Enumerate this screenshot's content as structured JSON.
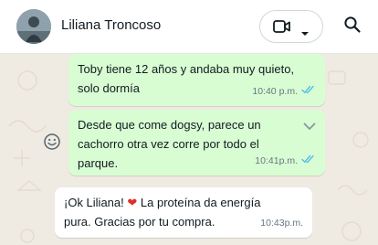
{
  "header": {
    "contact_name": "Liliana Troncoso"
  },
  "icons": {
    "video": "video-call-icon",
    "dropdown": "chevron-down-icon",
    "search": "search-icon",
    "emoji": "emoji-icon",
    "ticks": "double-check-icon"
  },
  "colors": {
    "outgoing_bubble": "#d9fdd3",
    "incoming_bubble": "#ffffff",
    "read_ticks": "#53bdeb",
    "background": "#efeae2"
  },
  "messages": [
    {
      "direction": "out",
      "lines": [
        "Toby tiene 12 años y andaba muy quieto,",
        "solo dormía"
      ],
      "time": "10:40 p.m."
    },
    {
      "direction": "out",
      "lines": [
        "Desde que come dogsy, parece un",
        "cachorro otra vez  corre por todo el",
        "parque."
      ],
      "time": "10:41p.m."
    },
    {
      "direction": "in",
      "line1_before": "¡Ok Liliana! ",
      "line1_emoji": "❤",
      "line1_after": " La proteína da energía",
      "line2": "pura. Gracias por tu compra.",
      "time": "10:43p.m."
    }
  ]
}
